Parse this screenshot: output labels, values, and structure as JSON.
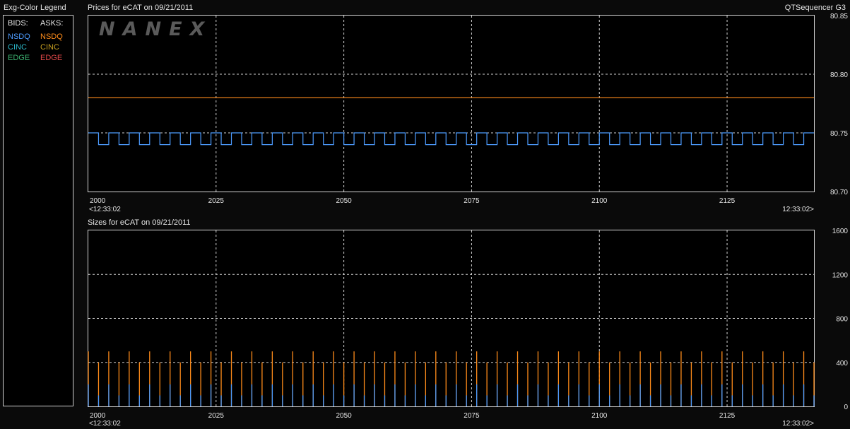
{
  "legend": {
    "title": "Exg-Color Legend",
    "bids_header": "BIDS:",
    "asks_header": "ASKS:",
    "bids": [
      {
        "label": "NSDQ",
        "color": "#4d9cff"
      },
      {
        "label": "CINC",
        "color": "#2bb7c9"
      },
      {
        "label": "EDGE",
        "color": "#3cb371"
      }
    ],
    "asks": [
      {
        "label": "NSDQ",
        "color": "#ff8c1a"
      },
      {
        "label": "CINC",
        "color": "#c8a020"
      },
      {
        "label": "EDGE",
        "color": "#e04848"
      }
    ]
  },
  "app_title": "QTSequencer G3",
  "watermark": "NANEX",
  "chart_data": [
    {
      "type": "line",
      "title": "Prices for  eCAT  on  09/21/2011",
      "x_range": [
        2000,
        2142
      ],
      "x_ticks": [
        2000,
        2025,
        2050,
        2075,
        2100,
        2125
      ],
      "x_tick_labels": [
        "2000",
        "2025",
        "2050",
        "2075",
        "2100",
        "2125"
      ],
      "x_start_label": "<12:33:02",
      "x_end_label": "12:33:02>",
      "ylim": [
        80.7,
        80.85
      ],
      "y_ticks": [
        80.7,
        80.75,
        80.8,
        80.85
      ],
      "y_tick_labels": [
        "80.70",
        "80.75",
        "80.80",
        "80.85"
      ],
      "series": [
        {
          "name": "NSDQ",
          "role": "ask",
          "color": "#ff8c1a",
          "kind": "constant",
          "value": 80.78
        },
        {
          "name": "NSDQ",
          "role": "bid",
          "color": "#4d9cff",
          "kind": "square_wave",
          "high": 80.75,
          "low": 80.74,
          "period": 4
        }
      ]
    },
    {
      "type": "bar",
      "title": "Sizes for  eCAT  on  09/21/2011",
      "x_range": [
        2000,
        2142
      ],
      "x_ticks": [
        2000,
        2025,
        2050,
        2075,
        2100,
        2125
      ],
      "x_tick_labels": [
        "2000",
        "2025",
        "2050",
        "2075",
        "2100",
        "2125"
      ],
      "x_start_label": "<12:33:02",
      "x_end_label": "12:33:02>",
      "ylim": [
        0,
        1600
      ],
      "y_ticks": [
        0,
        400,
        800,
        1200,
        1600
      ],
      "y_tick_labels": [
        "0",
        "400",
        "800",
        "1200",
        "1600"
      ],
      "series": [
        {
          "name": "NSDQ",
          "role": "ask",
          "color": "#ff8c1a",
          "kind": "alternating_spikes",
          "high": 500,
          "low": 400,
          "period": 4
        },
        {
          "name": "NSDQ",
          "role": "bid",
          "color": "#4d9cff",
          "kind": "alternating_spikes",
          "high": 200,
          "low": 100,
          "period": 4
        }
      ]
    }
  ]
}
